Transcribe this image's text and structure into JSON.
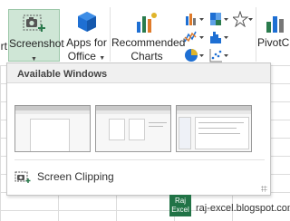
{
  "ribbon": {
    "cut_label": "rt",
    "screenshot_label": "Screenshot",
    "apps_label_1": "Apps for",
    "apps_label_2": "Office",
    "recommended_label_1": "Recommended",
    "recommended_label_2": "Charts",
    "pivot_label": "PivotC"
  },
  "panel": {
    "header": "Available Windows",
    "clip_label": "Screen Clipping"
  },
  "watermark": {
    "logo_text_1": "Raj",
    "logo_text_2": "Excel",
    "url": "raj-excel.blogspot.com"
  },
  "colors": {
    "accent_green": "#217346",
    "selected_bg": "#cfe6d6",
    "office_blue": "#1e6fd3"
  }
}
